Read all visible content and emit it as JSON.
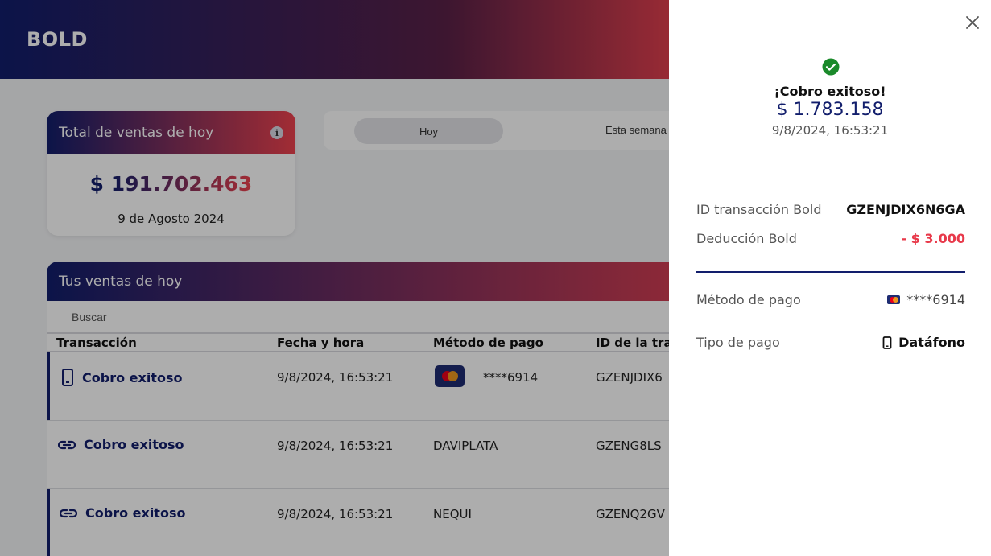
{
  "header": {
    "logo": "BOLD"
  },
  "total_card": {
    "title": "Total de ventas de hoy",
    "amount_currency": "$ ",
    "amount_value": "191.702.463",
    "date": "9 de Agosto 2024"
  },
  "period_tabs": {
    "today": "Hoy",
    "week": "Esta semana"
  },
  "sales": {
    "title": "Tus ventas de hoy",
    "search_placeholder": "Buscar",
    "columns": [
      "Transacción",
      "Fecha y hora",
      "Método de pago",
      "ID de la tra"
    ],
    "rows": [
      {
        "status": "Cobro exitoso",
        "icon": "phone-icon",
        "datetime": "9/8/2024, 16:53:21",
        "method": "****6914",
        "id": "GZENJDIX6"
      },
      {
        "status": "Cobro exitoso",
        "icon": "link-icon",
        "datetime": "9/8/2024, 16:53:21",
        "method": "DAVIPLATA",
        "id": "GZENG8LS"
      },
      {
        "status": "Cobro exitoso",
        "icon": "link-icon",
        "datetime": "9/8/2024, 16:53:21",
        "method": "NEQUI",
        "id": "GZENQ2GV"
      }
    ]
  },
  "drawer": {
    "title": "¡Cobro exitoso!",
    "amount": "$ 1.783.158",
    "datetime": "9/8/2024, 16:53:21",
    "details": {
      "id_label": "ID transacción Bold",
      "id_value": "GZENJDIX6N6GA",
      "deduction_label": "Deducción Bold",
      "deduction_value": "- $ 3.000",
      "method_label": "Método de pago",
      "method_value": "****6914",
      "type_label": "Tipo de pago",
      "type_value": "Datáfono"
    }
  },
  "colors": {
    "brand_navy": "#121e6c",
    "brand_red": "#ee424e",
    "success_green": "#1a8a2a",
    "deduction_red": "#e8394a"
  }
}
